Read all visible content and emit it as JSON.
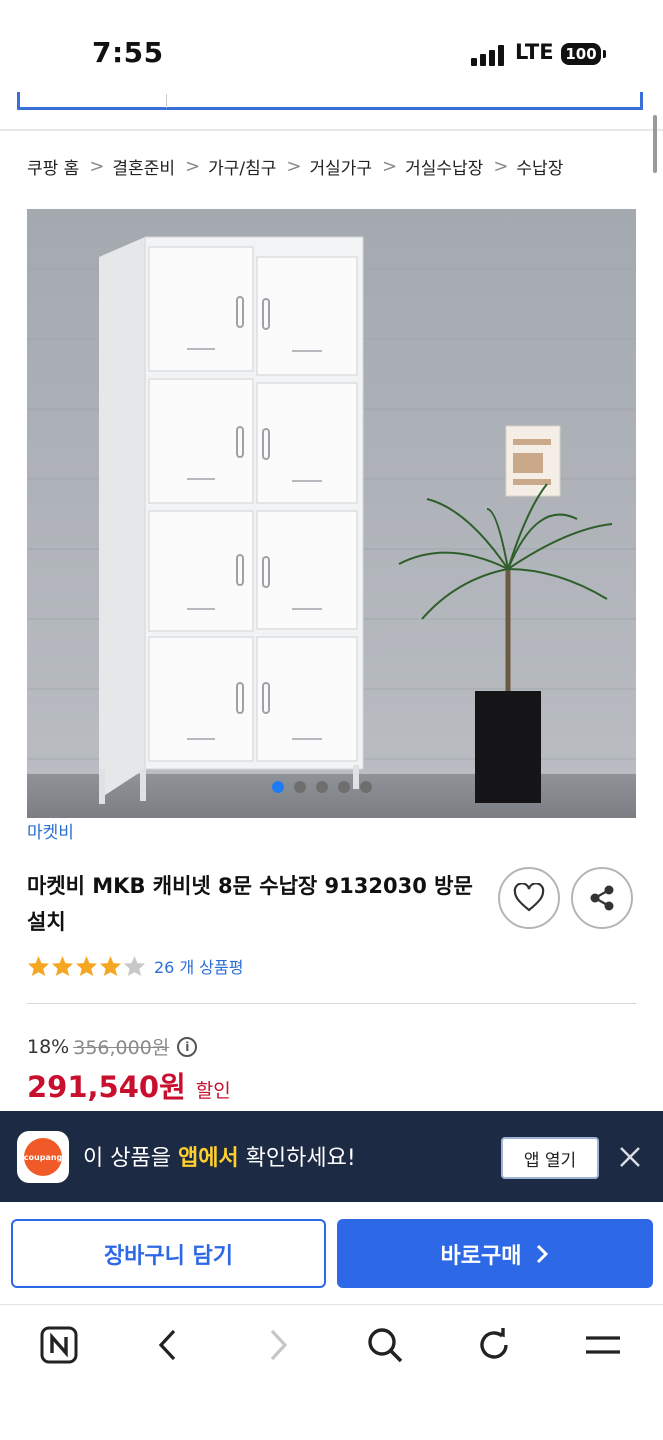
{
  "status_bar": {
    "time": "7:55",
    "network": "LTE",
    "battery": "100"
  },
  "breadcrumb": [
    "쿠팡 홈",
    "결혼준비",
    "가구/침구",
    "거실가구",
    "거실수납장",
    "수납장"
  ],
  "breadcrumb_separator": ">",
  "product": {
    "brand": "마켓비",
    "title": "마켓비 MKB 캐비넷 8문 수납장 9132030 방문설치",
    "rating": 4,
    "max_rating": 5,
    "review_count": "26 개 상품평",
    "image_count": 5,
    "current_image": 1
  },
  "price": {
    "discount_rate": "18%",
    "original": "356,000원",
    "info_icon": "i",
    "sale": "291,540원",
    "sale_label": "할인"
  },
  "app_banner": {
    "logo_text": "coupang",
    "text_before": "이 상품을 ",
    "text_highlight": "앱에서",
    "text_after": " 확인하세요!",
    "open_button": "앱 열기"
  },
  "actions": {
    "cart": "장바구니 담기",
    "buy": "바로구매"
  },
  "colors": {
    "accent": "#2d68e6",
    "sale": "#c8102e",
    "banner_bg": "#1d2a44",
    "star": "#f5a623"
  },
  "toolbar_icons": [
    "naver-n-icon",
    "back-icon",
    "forward-icon",
    "search-icon",
    "refresh-icon",
    "menu-icon"
  ]
}
